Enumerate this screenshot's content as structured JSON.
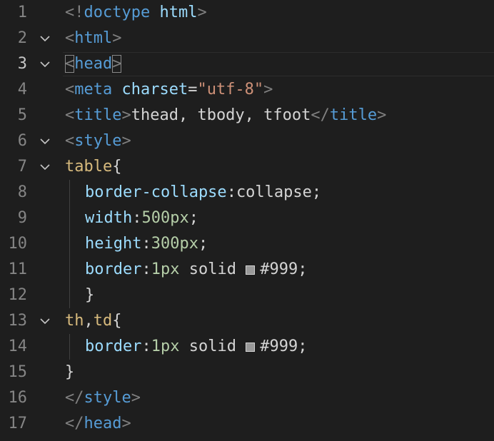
{
  "editor": {
    "colors": {
      "background": "#1e1e1e",
      "tag": "#569cd6",
      "attribute": "#9cdcfe",
      "string": "#ce9178",
      "selector": "#d7ba7d",
      "number": "#b5cea8",
      "swatch": "#999999"
    },
    "current_line": 3,
    "lines": [
      {
        "num": "1",
        "fold": false,
        "tokens": [
          [
            "punc",
            "<!"
          ],
          [
            "tag",
            "doctype"
          ],
          [
            "txt",
            " "
          ],
          [
            "attr",
            "html"
          ],
          [
            "punc",
            ">"
          ]
        ]
      },
      {
        "num": "2",
        "fold": true,
        "tokens": [
          [
            "punc",
            "<"
          ],
          [
            "tag",
            "html"
          ],
          [
            "punc",
            ">"
          ]
        ]
      },
      {
        "num": "3",
        "fold": true,
        "tokens": [
          [
            "punc-box",
            "<"
          ],
          [
            "tag",
            "head"
          ],
          [
            "punc-box",
            ">"
          ]
        ]
      },
      {
        "num": "4",
        "fold": false,
        "tokens": [
          [
            "punc",
            "<"
          ],
          [
            "tag",
            "meta"
          ],
          [
            "txt",
            " "
          ],
          [
            "attr",
            "charset"
          ],
          [
            "txt",
            "="
          ],
          [
            "str",
            "\"utf-8\""
          ],
          [
            "punc",
            ">"
          ]
        ]
      },
      {
        "num": "5",
        "fold": false,
        "tokens": [
          [
            "punc",
            "<"
          ],
          [
            "tag",
            "title"
          ],
          [
            "punc",
            ">"
          ],
          [
            "txt",
            "thead, tbody, tfoot"
          ],
          [
            "punc",
            "</"
          ],
          [
            "tag",
            "title"
          ],
          [
            "punc",
            ">"
          ]
        ]
      },
      {
        "num": "6",
        "fold": true,
        "tokens": [
          [
            "punc",
            "<"
          ],
          [
            "tag",
            "style"
          ],
          [
            "punc",
            ">"
          ]
        ]
      },
      {
        "num": "7",
        "fold": true,
        "tokens": [
          [
            "sel",
            "table"
          ],
          [
            "txt",
            "{"
          ]
        ]
      },
      {
        "num": "8",
        "fold": false,
        "indent": true,
        "tokens": [
          [
            "prop",
            "border-collapse"
          ],
          [
            "txt",
            ":"
          ],
          [
            "val",
            "collapse"
          ],
          [
            "txt",
            ";"
          ]
        ]
      },
      {
        "num": "9",
        "fold": false,
        "indent": true,
        "tokens": [
          [
            "prop",
            "width"
          ],
          [
            "txt",
            ":"
          ],
          [
            "num",
            "500px"
          ],
          [
            "txt",
            ";"
          ]
        ]
      },
      {
        "num": "10",
        "fold": false,
        "indent": true,
        "tokens": [
          [
            "prop",
            "height"
          ],
          [
            "txt",
            ":"
          ],
          [
            "num",
            "300px"
          ],
          [
            "txt",
            ";"
          ]
        ]
      },
      {
        "num": "11",
        "fold": false,
        "indent": true,
        "tokens": [
          [
            "prop",
            "border"
          ],
          [
            "txt",
            ":"
          ],
          [
            "num",
            "1px"
          ],
          [
            "txt",
            " "
          ],
          [
            "val",
            "solid"
          ],
          [
            "txt",
            " "
          ],
          [
            "swatch",
            "#999999"
          ],
          [
            "val",
            "#999"
          ],
          [
            "txt",
            ";"
          ]
        ]
      },
      {
        "num": "12",
        "fold": false,
        "indent": true,
        "tokens": [
          [
            "txt",
            "}"
          ]
        ]
      },
      {
        "num": "13",
        "fold": true,
        "tokens": [
          [
            "sel",
            "th"
          ],
          [
            "txt",
            ","
          ],
          [
            "sel",
            "td"
          ],
          [
            "txt",
            "{"
          ]
        ]
      },
      {
        "num": "14",
        "fold": false,
        "indent": true,
        "tokens": [
          [
            "prop",
            "border"
          ],
          [
            "txt",
            ":"
          ],
          [
            "num",
            "1px"
          ],
          [
            "txt",
            " "
          ],
          [
            "val",
            "solid"
          ],
          [
            "txt",
            " "
          ],
          [
            "swatch",
            "#999999"
          ],
          [
            "val",
            "#999"
          ],
          [
            "txt",
            ";"
          ]
        ]
      },
      {
        "num": "15",
        "fold": false,
        "tokens": [
          [
            "txt",
            "}"
          ]
        ]
      },
      {
        "num": "16",
        "fold": false,
        "tokens": [
          [
            "punc",
            "</"
          ],
          [
            "tag",
            "style"
          ],
          [
            "punc",
            ">"
          ]
        ]
      },
      {
        "num": "17",
        "fold": false,
        "tokens": [
          [
            "punc",
            "</"
          ],
          [
            "tag",
            "head"
          ],
          [
            "punc",
            ">"
          ]
        ]
      }
    ]
  }
}
